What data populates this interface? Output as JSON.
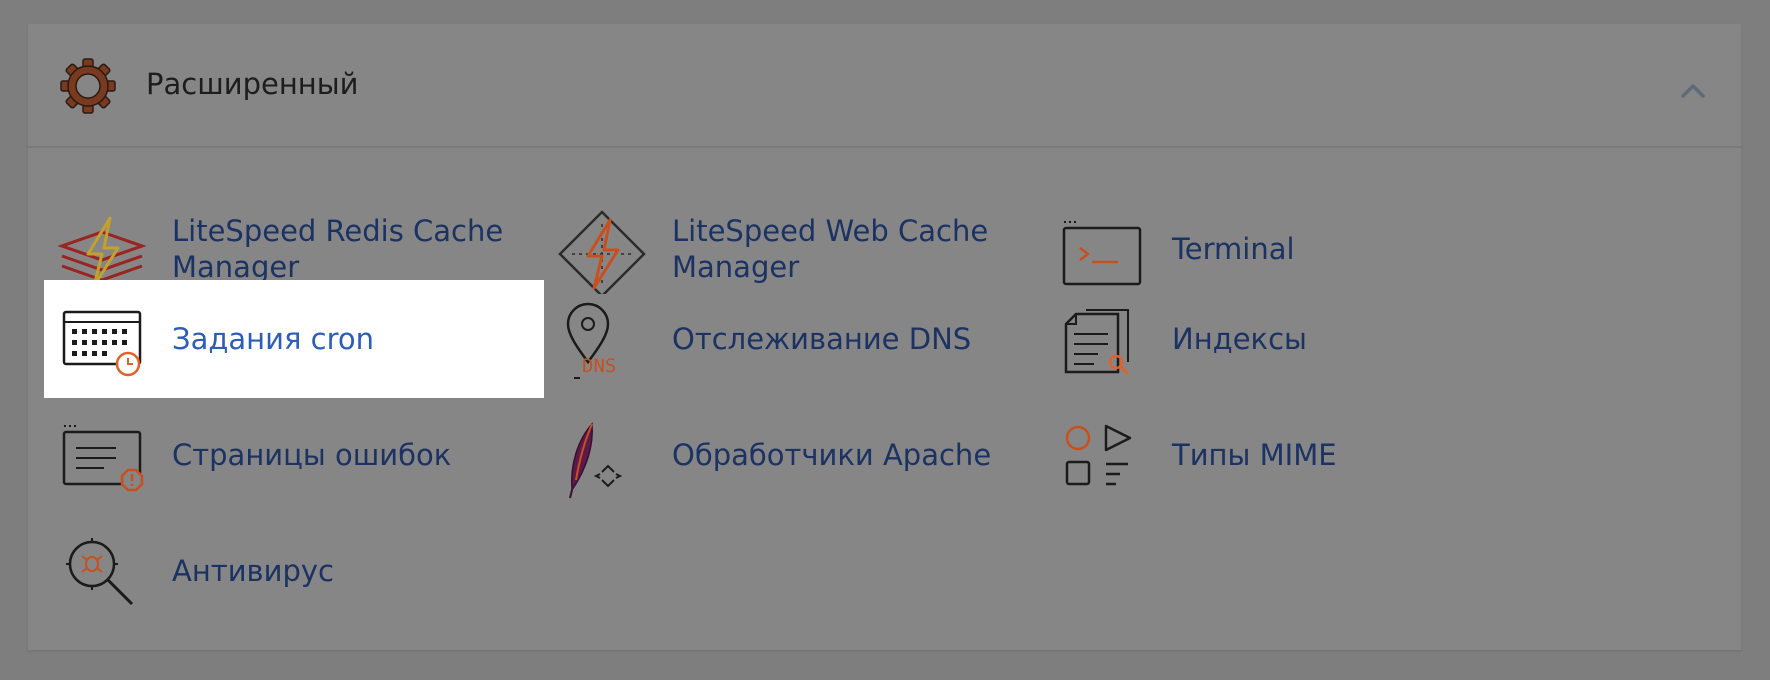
{
  "section": {
    "title": "Расширенный",
    "icon": "gear-icon",
    "collapse_icon": "chevron-up-icon"
  },
  "items": [
    {
      "label": "LiteSpeed Redis Cache Manager",
      "icon": "litespeed-redis-icon"
    },
    {
      "label": "LiteSpeed Web Cache Manager",
      "icon": "litespeed-webcache-icon"
    },
    {
      "label": "Terminal",
      "icon": "terminal-icon"
    },
    {
      "label": "Задания cron",
      "icon": "cron-calendar-icon",
      "selected": true
    },
    {
      "label": "Отслеживание DNS",
      "icon": "dns-pin-icon"
    },
    {
      "label": "Индексы",
      "icon": "index-document-icon"
    },
    {
      "label": "Страницы ошибок",
      "icon": "error-page-icon"
    },
    {
      "label": "Обработчики Apache",
      "icon": "apache-feather-icon"
    },
    {
      "label": "Типы MIME",
      "icon": "mime-shapes-icon"
    },
    {
      "label": "Антивирус",
      "icon": "antivirus-icon"
    }
  ],
  "dns_icon_text": "DNS",
  "colors": {
    "accent_orange": "#c8501e",
    "link_blue": "#1b3263",
    "active_blue": "#2d5db8",
    "overlay": "#868686"
  }
}
